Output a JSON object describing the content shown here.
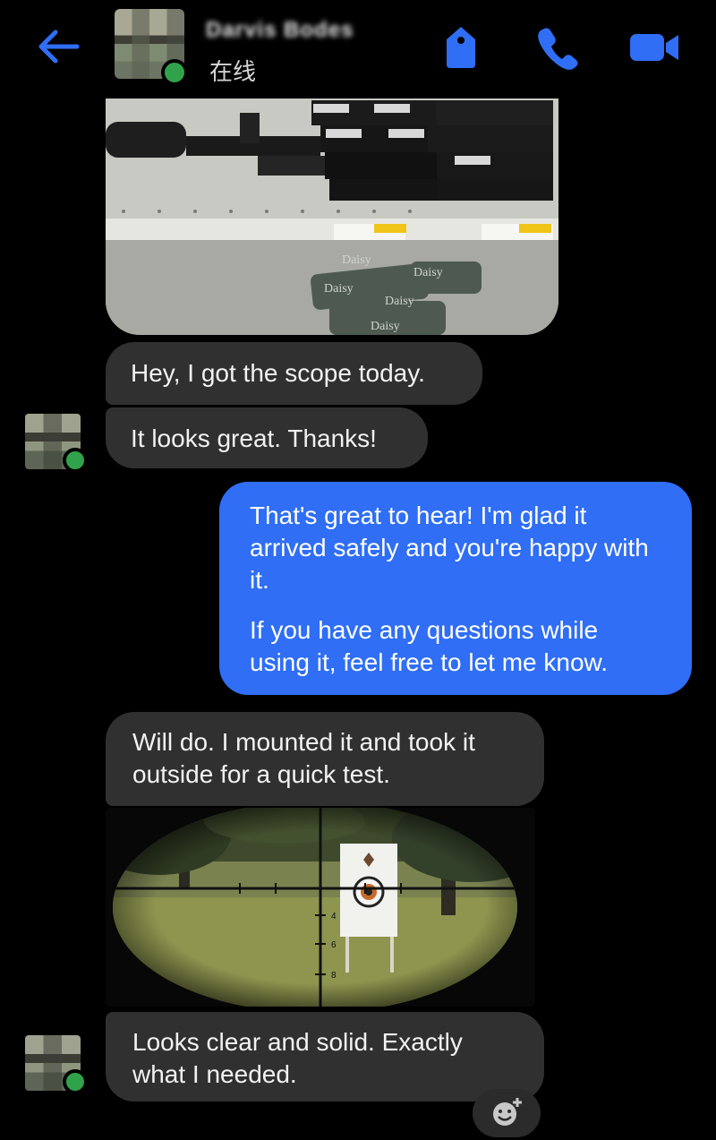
{
  "header": {
    "contact_name": "Darvis Bodes",
    "status": "在线",
    "icons": [
      "back-arrow-icon",
      "tag-icon",
      "phone-icon",
      "video-camera-icon"
    ],
    "accent_color": "#2f6ef5",
    "online_color": "#31a24c"
  },
  "messages": [
    {
      "from": "contact",
      "type": "image",
      "alt": "store shelf photo"
    },
    {
      "from": "contact",
      "type": "text",
      "text": "Hey, I got the scope today."
    },
    {
      "from": "contact",
      "type": "text",
      "text": "It looks great. Thanks!"
    },
    {
      "from": "me",
      "type": "text",
      "paragraphs": [
        "That's great to hear! I'm glad it arrived safely and you're happy with it.",
        "If you have any questions while using it, feel free to let me know."
      ]
    },
    {
      "from": "contact",
      "type": "text",
      "text": "Will do. I mounted it and took it outside for a quick test."
    },
    {
      "from": "contact",
      "type": "image",
      "alt": "scope view photo",
      "reticle_marks": [
        "4",
        "6",
        "8"
      ]
    },
    {
      "from": "contact",
      "type": "text",
      "text": "Looks clear and solid. Exactly what I needed."
    }
  ],
  "photo_shelf_labels": [
    "Daisy",
    "Daisy",
    "Daisy",
    "Daisy",
    "Daisy"
  ],
  "reaction_button": {
    "icon": "add-reaction-icon"
  }
}
